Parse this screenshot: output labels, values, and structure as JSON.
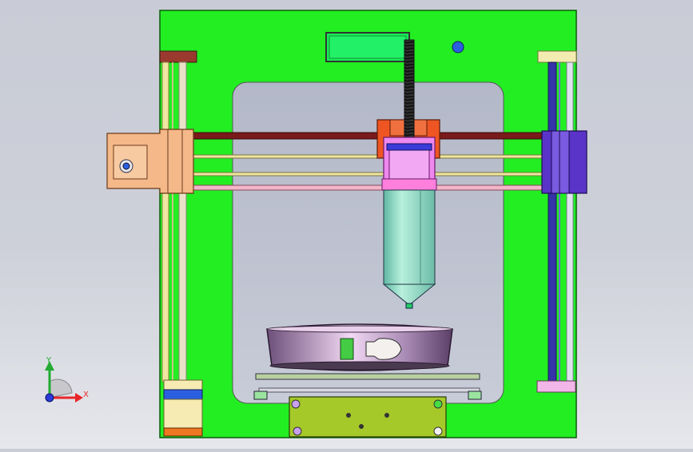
{
  "viewport": {
    "background_top": "#c9ccd6",
    "background_bottom": "#e6e7ec",
    "frame_color": "#22ee22",
    "window_color": "#b6bccb"
  },
  "triad": {
    "x_label": "X",
    "y_label": "Y",
    "x_color": "#e8262a",
    "y_color": "#22aa33",
    "origin_color": "#2a3ad6"
  },
  "colors": {
    "lcd": "#14ee55",
    "knob": "#2b5fe0",
    "extruder_top": "#ee5522",
    "carriage": "#ee88ee",
    "nozzle": "#9fe0c9",
    "rod_left": "#f0e6a0",
    "rod_right": "#3434a8",
    "left_block": "#f4b889",
    "right_block": "#5a34c8",
    "spool": "#c8a6d6",
    "board": "#a6c92a"
  }
}
